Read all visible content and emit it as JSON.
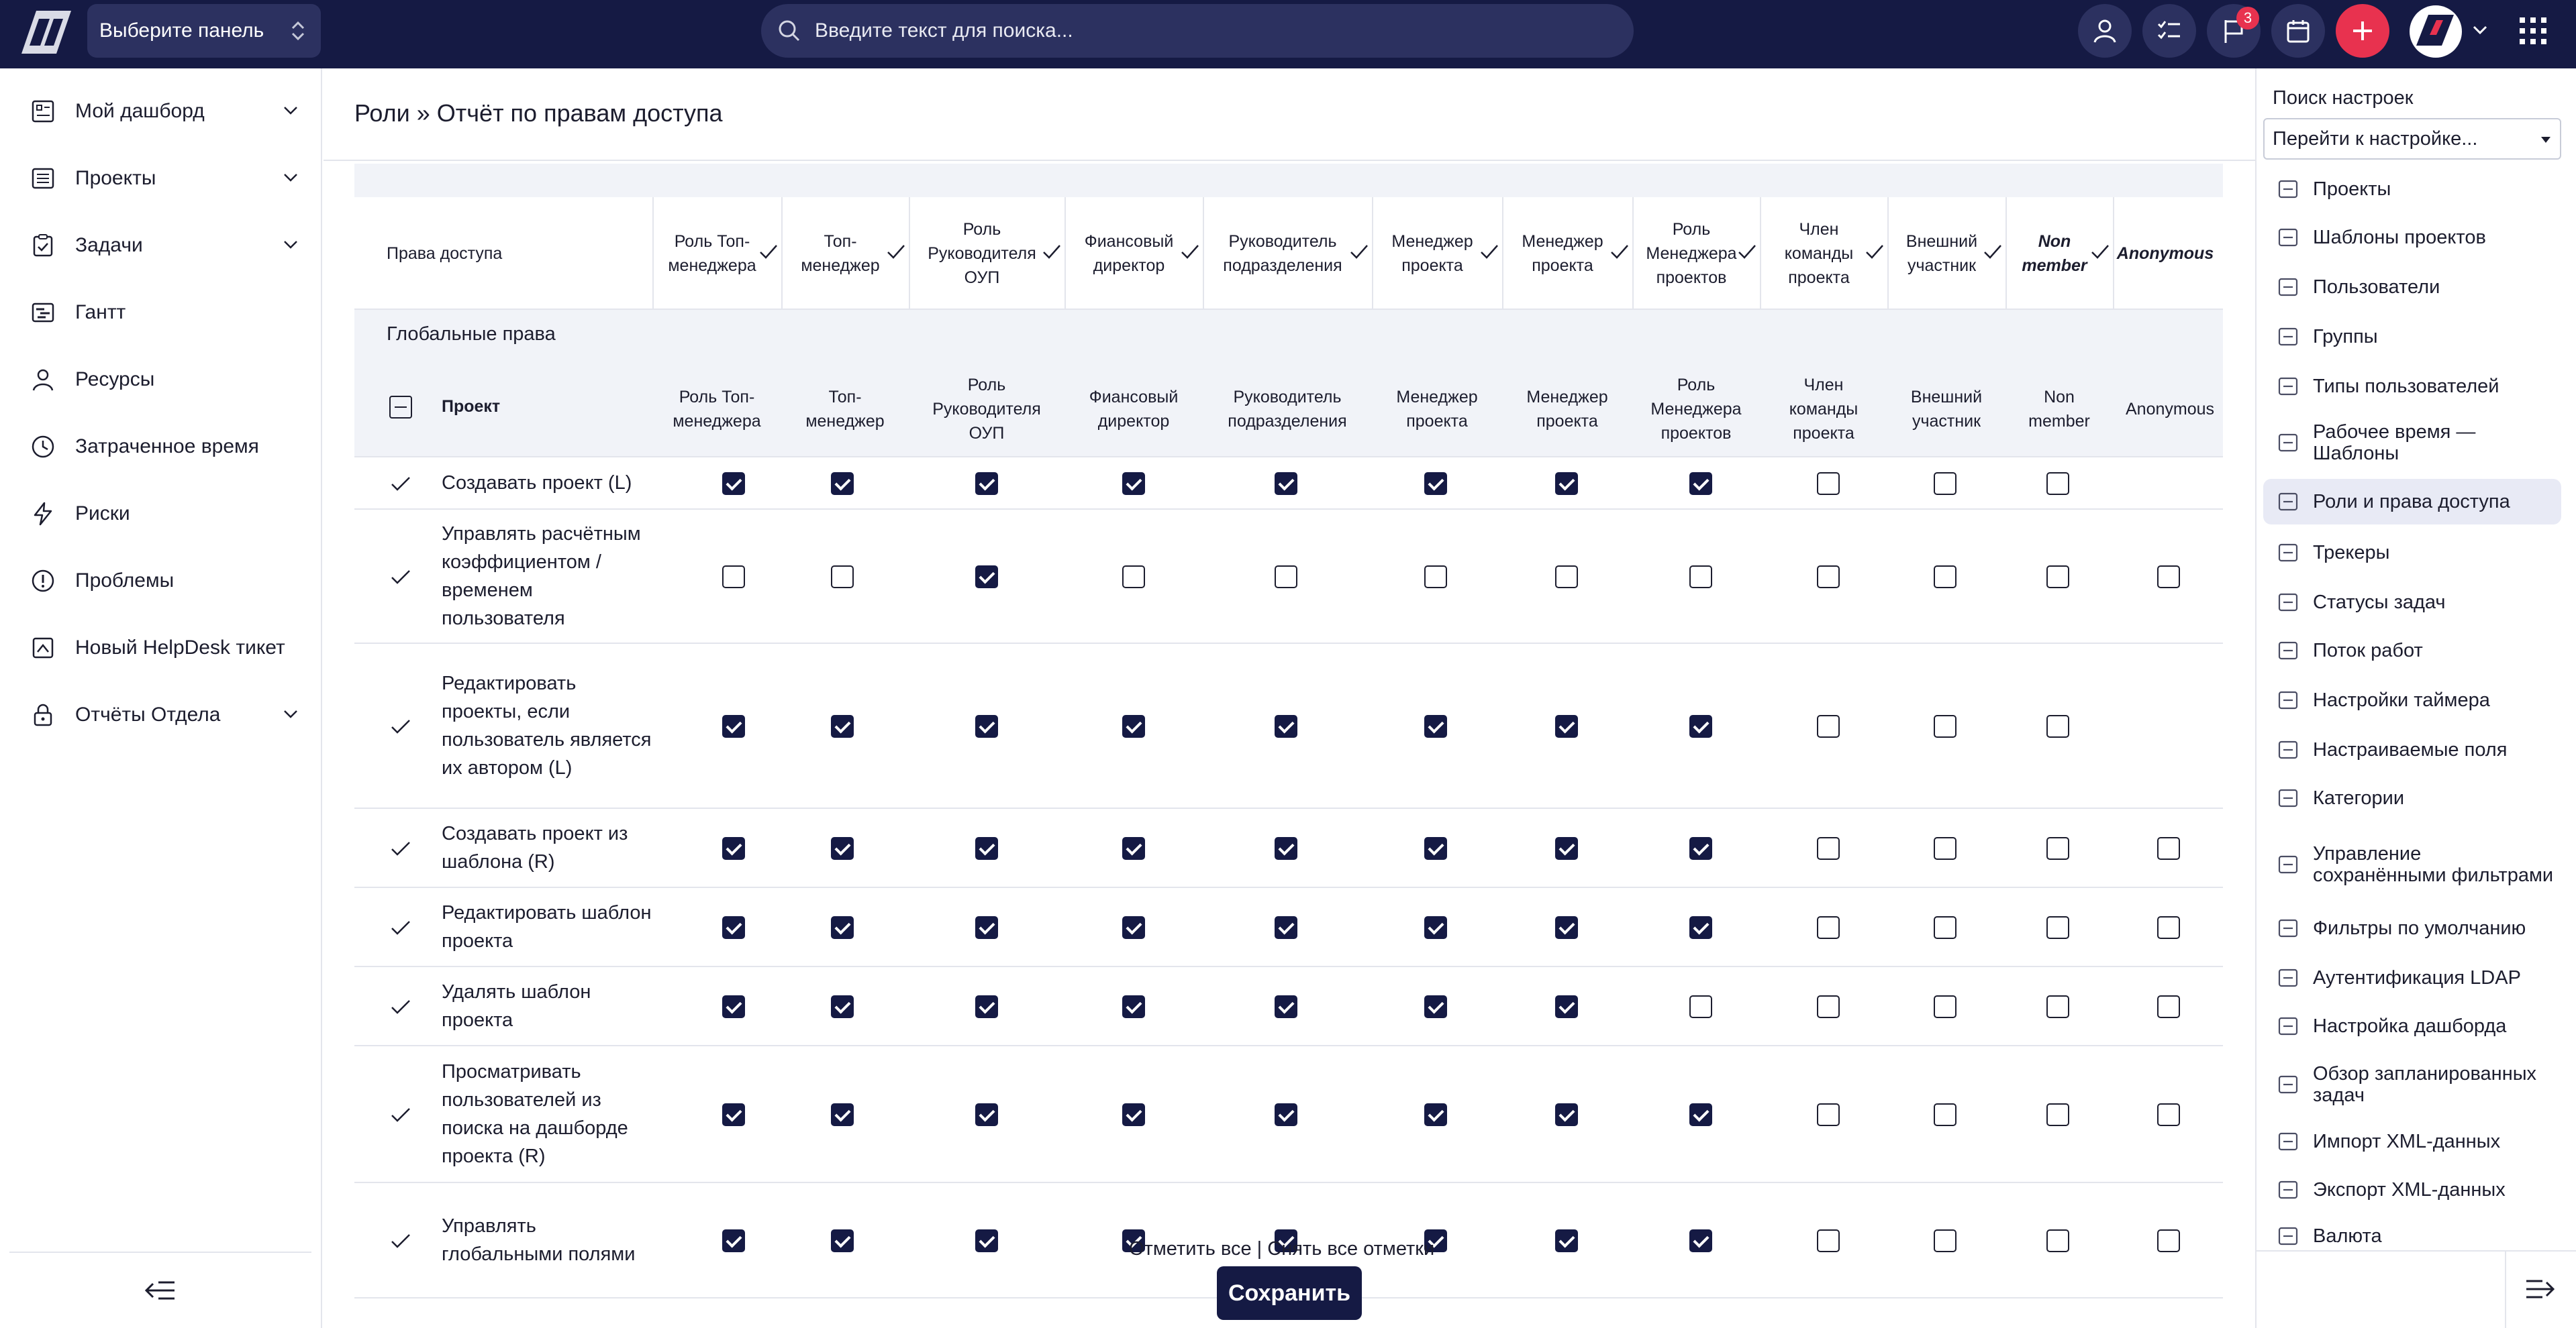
{
  "topbar": {
    "panel_select": "Выберите панель",
    "search_placeholder": "Введите текст для поиска...",
    "notifications_count": "3"
  },
  "sidebar": {
    "items": [
      {
        "label": "Мой дашборд",
        "icon": "dashboard-icon",
        "expandable": true
      },
      {
        "label": "Проекты",
        "icon": "projects-icon",
        "expandable": true
      },
      {
        "label": "Задачи",
        "icon": "tasks-icon",
        "expandable": true
      },
      {
        "label": "Гантт",
        "icon": "gantt-icon",
        "expandable": false
      },
      {
        "label": "Ресурсы",
        "icon": "user-icon",
        "expandable": false
      },
      {
        "label": "Затраченное время",
        "icon": "clock-icon",
        "expandable": false
      },
      {
        "label": "Риски",
        "icon": "lightning-icon",
        "expandable": false
      },
      {
        "label": "Проблемы",
        "icon": "alert-icon",
        "expandable": false
      },
      {
        "label": "Новый HelpDesk тикет",
        "icon": "helpdesk-icon",
        "expandable": false
      },
      {
        "label": "Отчёты Отдела",
        "icon": "lock-icon",
        "expandable": true
      }
    ]
  },
  "main": {
    "title": "Роли » Отчёт по правам доступа",
    "rights_label": "Права доступа",
    "group_label": "Глобальные права",
    "project_label": "Проект",
    "columns_top": [
      "Роль Топ-менеджера",
      "Топ-менеджер",
      "Роль Руководителя ОУП",
      "Фиансовый директор",
      "Руководитель подразделения",
      "Менеджер проекта",
      "Менеджер проекта",
      "Роль Менеджера проектов",
      "Член команды проекта",
      "Внешний участник",
      "Non member",
      "Anonymous"
    ],
    "columns_sub": [
      "Роль Топ-менеджера",
      "Топ-менеджер",
      "Роль Руководителя ОУП",
      "Фиансовый директор",
      "Руководитель подразделения",
      "Менеджер проекта",
      "Менеджер проекта",
      "Роль Менеджера проектов",
      "Член команды проекта",
      "Внешний участник",
      "Non member",
      "Anonymous"
    ],
    "rows": [
      {
        "name": "Создавать проект  (L)",
        "checks": [
          1,
          1,
          1,
          1,
          1,
          1,
          1,
          1,
          0,
          0,
          0,
          null
        ]
      },
      {
        "name": "Управлять расчётным коэффициентом / временем пользователя",
        "checks": [
          0,
          0,
          1,
          0,
          0,
          0,
          0,
          0,
          0,
          0,
          0,
          0
        ]
      },
      {
        "name": "Редактировать проекты, если пользователь является их автором  (L)",
        "checks": [
          1,
          1,
          1,
          1,
          1,
          1,
          1,
          1,
          0,
          0,
          0,
          null
        ]
      },
      {
        "name": "Создавать проект из шаблона  (R)",
        "checks": [
          1,
          1,
          1,
          1,
          1,
          1,
          1,
          1,
          0,
          0,
          0,
          0
        ]
      },
      {
        "name": "Редактировать шаблон проекта",
        "checks": [
          1,
          1,
          1,
          1,
          1,
          1,
          1,
          1,
          0,
          0,
          0,
          0
        ]
      },
      {
        "name": "Удалять шаблон проекта",
        "checks": [
          1,
          1,
          1,
          1,
          1,
          1,
          1,
          0,
          0,
          0,
          0,
          0
        ]
      },
      {
        "name": "Просматривать пользователей из поиска на дашборде проекта  (R)",
        "checks": [
          1,
          1,
          1,
          1,
          1,
          1,
          1,
          1,
          0,
          0,
          0,
          0
        ]
      },
      {
        "name": "Управлять глобальными полями",
        "checks": [
          1,
          1,
          1,
          1,
          1,
          1,
          1,
          1,
          0,
          0,
          0,
          0
        ]
      }
    ],
    "check_all": "Отметить все",
    "separator": "|",
    "uncheck_all": "Снять все отметки",
    "save": "Сохранить"
  },
  "right_sidebar": {
    "search_label": "Поиск настроек",
    "select_value": "Перейти к настройке...",
    "items": [
      {
        "label": "Проекты",
        "icon": "projects-tree-icon"
      },
      {
        "label": "Шаблоны проектов",
        "icon": "templates-icon"
      },
      {
        "label": "Пользователи",
        "icon": "user-icon"
      },
      {
        "label": "Группы",
        "icon": "groups-icon"
      },
      {
        "label": "Типы пользователей",
        "icon": "user-types-icon"
      },
      {
        "label": "Рабочее время — Шаблоны",
        "icon": "calendar-icon"
      },
      {
        "label": "Роли и права доступа",
        "icon": "roles-icon",
        "active": true
      },
      {
        "label": "Трекеры",
        "icon": "tracker-icon"
      },
      {
        "label": "Статусы задач",
        "icon": "statuses-icon"
      },
      {
        "label": "Поток работ",
        "icon": "workflow-icon"
      },
      {
        "label": "Настройки таймера",
        "icon": "timer-icon"
      },
      {
        "label": "Настраиваемые поля",
        "icon": "custom-fields-icon"
      },
      {
        "label": "Категории",
        "icon": "categories-icon"
      },
      {
        "label": "Управление сохранёнными фильтрами",
        "icon": "saved-filters-icon"
      },
      {
        "label": "Фильтры по умолчанию",
        "icon": "filter-icon"
      },
      {
        "label": "Аутентификация LDAP",
        "icon": "ldap-icon"
      },
      {
        "label": "Настройка дашборда",
        "icon": "dashboard-settings-icon"
      },
      {
        "label": "Обзор запланированных задач",
        "icon": "scheduled-icon"
      },
      {
        "label": "Импорт XML-данных",
        "icon": "import-icon"
      },
      {
        "label": "Экспорт XML-данных",
        "icon": "export-icon"
      },
      {
        "label": "Валюта",
        "icon": "currency-icon"
      }
    ]
  },
  "colors": {
    "topbar": "#151a44",
    "accent_red": "#e8324f",
    "checkbox_on": "#151a44",
    "active_bg": "#e8eaf5"
  }
}
